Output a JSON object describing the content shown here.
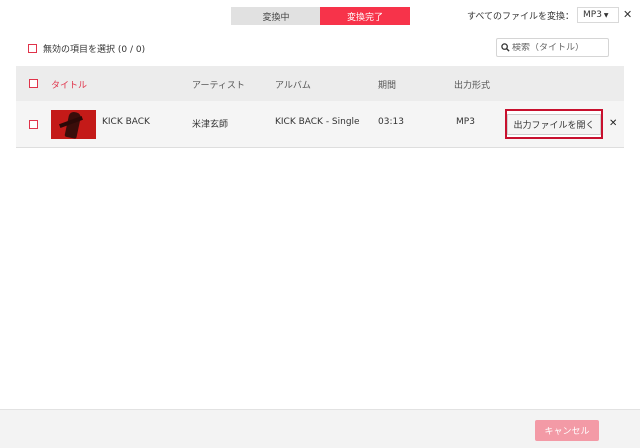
{
  "tabs": {
    "converting": "変換中",
    "converted": "変換完了"
  },
  "convert_all": {
    "label": "すべてのファイルを変換：",
    "format": "MP3"
  },
  "select_invalid": {
    "label": "無効の項目を選択 (0 / 0)"
  },
  "search": {
    "placeholder": "検索（タイトル）"
  },
  "table": {
    "headers": {
      "title": "タイトル",
      "artist": "アーティスト",
      "album": "アルバム",
      "duration": "期間",
      "format": "出力形式"
    },
    "rows": [
      {
        "title": "KICK BACK",
        "artist": "米津玄師",
        "album": "KICK BACK - Single",
        "duration": "03:13",
        "format": "MP3",
        "open_label": "出力ファイルを開く"
      }
    ]
  },
  "footer": {
    "cancel_label": "キャンセル"
  },
  "colors": {
    "accent": "#f7334a",
    "highlight_border": "#c8102e",
    "cancel_bg": "#f39aa6"
  }
}
